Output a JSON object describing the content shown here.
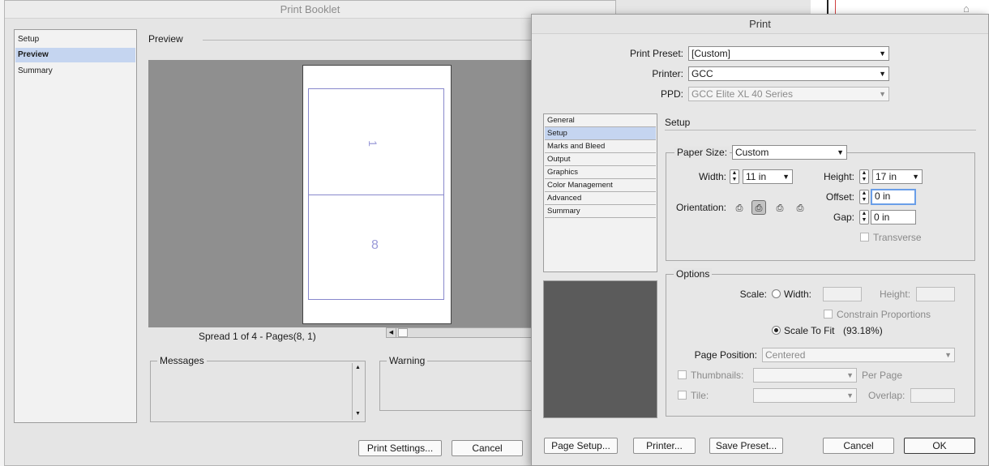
{
  "booklet": {
    "title": "Print Booklet",
    "sidebar": [
      "Setup",
      "Preview",
      "Summary"
    ],
    "preview_heading": "Preview",
    "page_numbers": [
      "1",
      "8"
    ],
    "spread_label": "Spread 1 of 4 - Pages(8, 1)",
    "messages_label": "Messages",
    "warning_label": "Warning",
    "print_settings_label": "Print Settings...",
    "cancel_label": "Cancel"
  },
  "print": {
    "title": "Print",
    "preset_label": "Print Preset:",
    "preset_value": "[Custom]",
    "printer_label": "Printer:",
    "printer_value": "GCC",
    "ppd_label": "PPD:",
    "ppd_value": "GCC Elite XL 40 Series",
    "nav": [
      "General",
      "Setup",
      "Marks and Bleed",
      "Output",
      "Graphics",
      "Color Management",
      "Advanced",
      "Summary"
    ],
    "setup_heading": "Setup",
    "paper_size_label": "Paper Size:",
    "paper_size_value": "Custom",
    "width_label": "Width:",
    "width_value": "11 in",
    "height_label": "Height:",
    "height_value": "17 in",
    "offset_label": "Offset:",
    "offset_value": "0 in",
    "gap_label": "Gap:",
    "gap_value": "0 in",
    "orientation_label": "Orientation:",
    "transverse_label": "Transverse",
    "options_label": "Options",
    "scale_label": "Scale:",
    "scale_width_label": "Width:",
    "scale_height_label": "Height:",
    "constrain_label": "Constrain Proportions",
    "scale_to_fit_label": "Scale To Fit",
    "scale_to_fit_value": "(93.18%)",
    "page_position_label": "Page Position:",
    "page_position_value": "Centered",
    "thumbnails_label": "Thumbnails:",
    "per_page_label": "Per Page",
    "tile_label": "Tile:",
    "overlap_label": "Overlap:",
    "buttons": {
      "page_setup": "Page Setup...",
      "printer": "Printer...",
      "save_preset": "Save Preset...",
      "cancel": "Cancel",
      "ok": "OK"
    }
  }
}
